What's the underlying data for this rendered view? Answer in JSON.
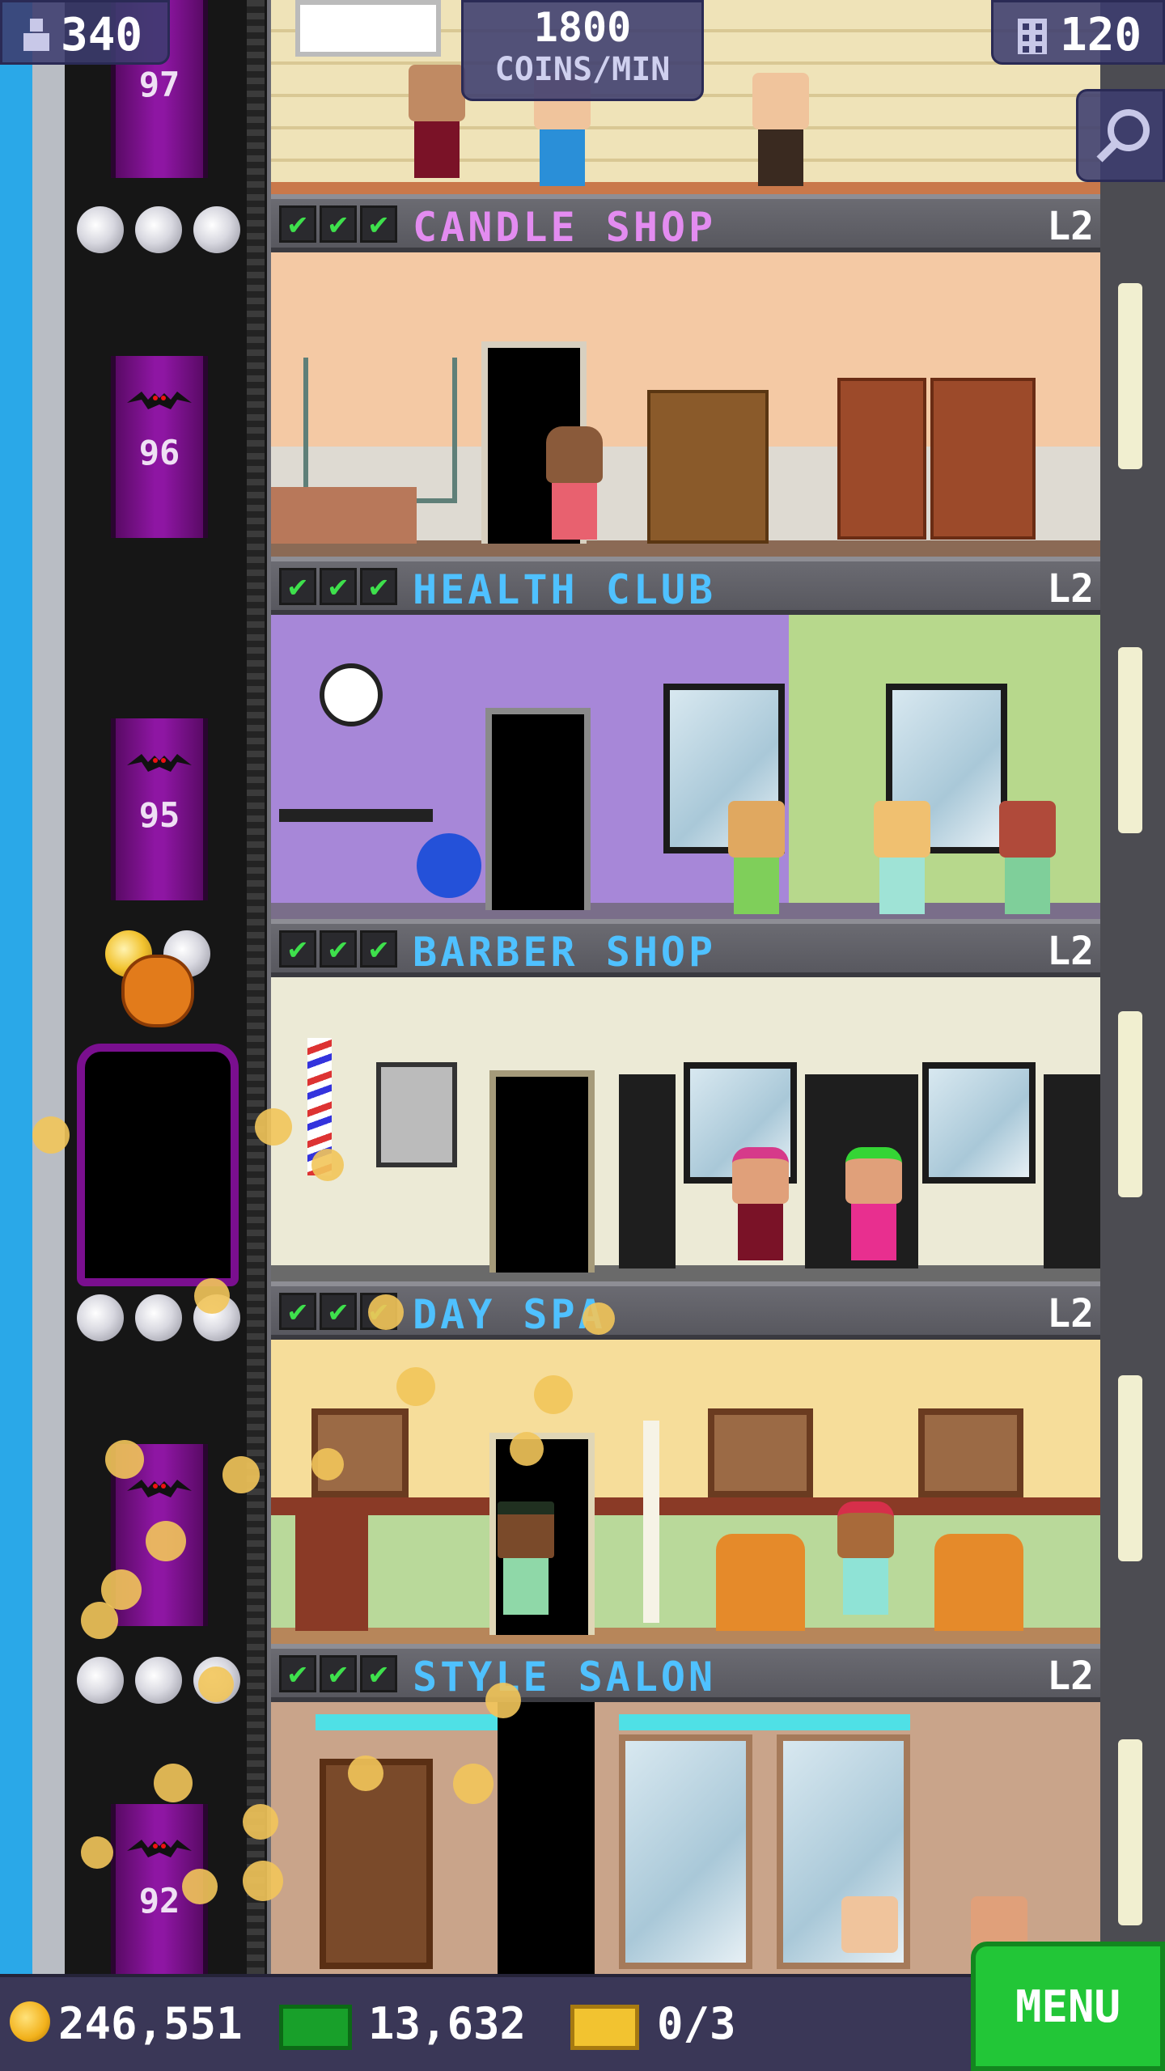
{
  "hud": {
    "population": "340",
    "income_value": "1800",
    "income_unit": "COINS/MIN",
    "floors": "120"
  },
  "elevator": {
    "floors": [
      "97",
      "96",
      "95",
      "92"
    ]
  },
  "floors": [
    {
      "name": "CANDLE SHOP",
      "level": "L2",
      "name_color": "#e38cf0"
    },
    {
      "name": "HEALTH CLUB",
      "level": "L2",
      "name_color": "#4fc1ff"
    },
    {
      "name": "BARBER SHOP",
      "level": "L2",
      "name_color": "#4fc1ff"
    },
    {
      "name": "DAY SPA",
      "level": "L2",
      "name_color": "#4fc1ff"
    },
    {
      "name": "STYLE SALON",
      "level": "L2",
      "name_color": "#4fc1ff"
    }
  ],
  "check_mark": "✔",
  "bottom": {
    "coins": "246,551",
    "bux": "13,632",
    "tickets": "0/3",
    "menu_label": "MENU"
  },
  "colors": {
    "accent_green": "#22c637",
    "elevator_purple": "#8e16a3",
    "check_green": "#3ee04c"
  }
}
